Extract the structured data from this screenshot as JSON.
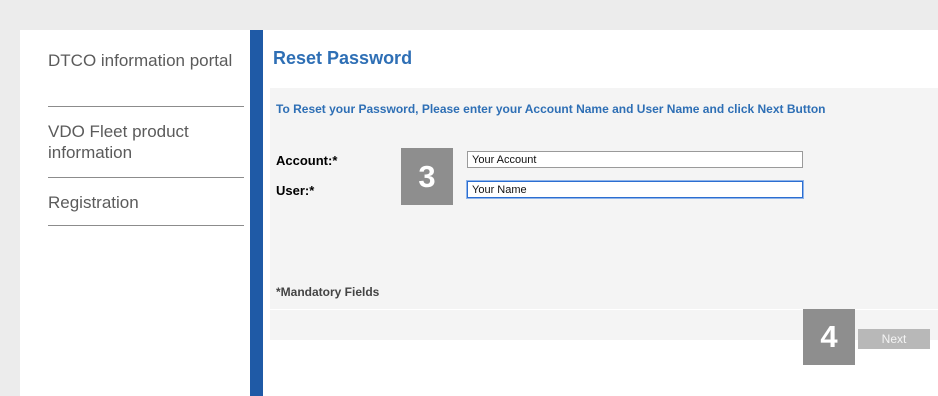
{
  "sidebar": {
    "items": [
      {
        "label": "DTCO information portal"
      },
      {
        "label": "VDO Fleet product information"
      },
      {
        "label": "Registration"
      }
    ]
  },
  "page": {
    "title": "Reset Password",
    "instruction": "To Reset your Password, Please enter your Account Name and User Name and click Next Button"
  },
  "form": {
    "account_label": "Account:*",
    "account_value": "Your Account",
    "user_label": "User:*",
    "user_value": "Your Name",
    "mandatory_note": "*Mandatory Fields"
  },
  "badges": {
    "step_three": "3",
    "step_four": "4"
  },
  "actions": {
    "next_label": "Next"
  },
  "colors": {
    "accent_blue": "#2e6fb5",
    "sidebar_bar": "#1f5aa6",
    "badge_gray": "#8e8e8e",
    "button_gray": "#b8b8b8"
  }
}
